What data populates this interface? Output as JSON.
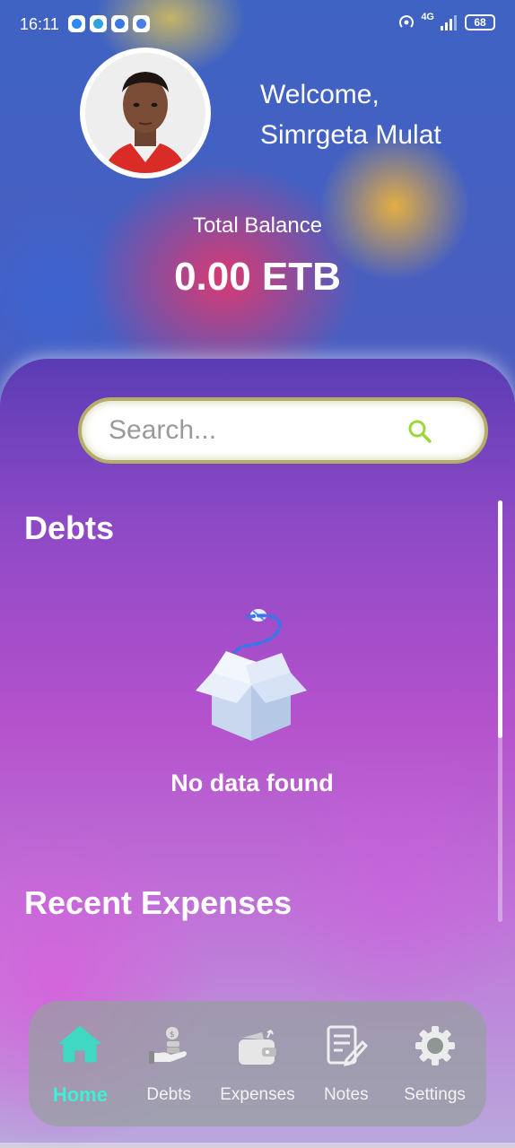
{
  "status_bar": {
    "time": "16:11",
    "notification_icons": [
      "chat-bubble-icon",
      "telegram-icon",
      "chrome-icon",
      "gmail-icon"
    ],
    "network": "4G",
    "battery": "68"
  },
  "header": {
    "welcome": "Welcome,",
    "user_name": "Simrgeta Mulat",
    "balance_label": "Total Balance",
    "balance_value": "0.00 ETB"
  },
  "search": {
    "placeholder": "Search..."
  },
  "sections": {
    "debts_title": "Debts",
    "empty_message": "No data found",
    "expenses_title": "Recent Expenses"
  },
  "nav": {
    "active": "Home",
    "items": [
      {
        "label": "Home",
        "icon": "home-icon"
      },
      {
        "label": "Debts",
        "icon": "money-hand-icon"
      },
      {
        "label": "Expenses",
        "icon": "wallet-icon"
      },
      {
        "label": "Notes",
        "icon": "note-edit-icon"
      },
      {
        "label": "Settings",
        "icon": "gear-icon"
      }
    ]
  },
  "colors": {
    "active_nav": "#3ff0d6",
    "search_border": "#b4ad6a",
    "panel_top": "#5a3cb4",
    "panel_mid": "#b451cc"
  }
}
